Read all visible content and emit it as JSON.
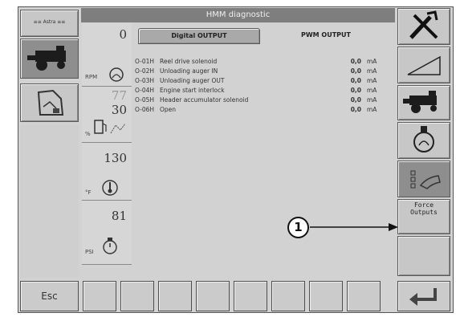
{
  "window": {
    "title": "HMM diagnostic"
  },
  "tabs": [
    {
      "label": "Digital OUTPUT",
      "active": true
    },
    {
      "label": "PWM OUTPUT",
      "active": false
    }
  ],
  "gauges": {
    "rpm": {
      "value": "0",
      "unit": "RPM"
    },
    "fuel": {
      "value_top": "77",
      "value_bottom": "30",
      "unit": "%"
    },
    "temperature": {
      "value": "130",
      "unit": "°F"
    },
    "pressure": {
      "value": "81",
      "unit": "PSI"
    }
  },
  "outputs": [
    {
      "code": "O-01H",
      "name": "Reel drive solenoid",
      "value": "0,0",
      "unit": "mA"
    },
    {
      "code": "O-02H",
      "name": "Unloading auger IN",
      "value": "0,0",
      "unit": "mA"
    },
    {
      "code": "O-03H",
      "name": "Unloading auger OUT",
      "value": "0,0",
      "unit": "mA"
    },
    {
      "code": "O-04H",
      "name": "Engine start interlock",
      "value": "0,0",
      "unit": "mA"
    },
    {
      "code": "O-05H",
      "name": "Header accumulator solenoid",
      "value": "0,0",
      "unit": "mA"
    },
    {
      "code": "O-06H",
      "name": "Open",
      "value": "0,0",
      "unit": "mA"
    }
  ],
  "right_panel": {
    "force_outputs_label_line1": "Force",
    "force_outputs_label_line2": "Outputs"
  },
  "bottom_bar": {
    "esc_label": "Esc"
  },
  "callout": {
    "number": "1"
  },
  "left_panel": {
    "logo_text": "≡≡ Astra ≡≡"
  },
  "colors": {
    "panel": "#d2d2d2",
    "titlebar": "#7e7e7e",
    "button": "#c7c7c7",
    "selected_button": "#8e8e8e"
  },
  "icons": [
    "combine-harvester-icon",
    "field-map-icon",
    "tools-icon",
    "ramp-icon",
    "engine-icon",
    "hand-touch-icon",
    "enter-icon",
    "fuel-pump-icon",
    "thermometer-icon",
    "pressure-gauge-icon"
  ]
}
